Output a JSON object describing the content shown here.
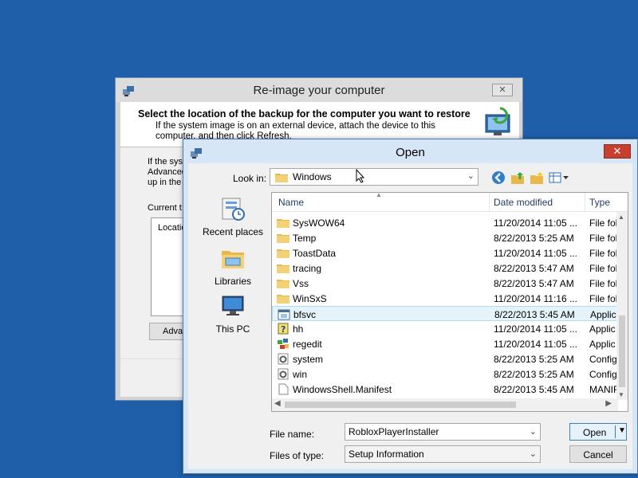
{
  "reimage": {
    "title": "Re-image your computer",
    "header_title": "Select the location of the backup for the computer you want to restore",
    "header_desc": "If the system image is on an external device, attach the device to this computer, and then click Refresh.",
    "body_text": "If the sys Advanced up in the",
    "current_label": "Current t",
    "list_column": "Location",
    "advanced_button": "Adva",
    "close_glyph": "✕"
  },
  "open_dialog": {
    "title": "Open",
    "close_glyph": "✕",
    "look_in_label": "Look in:",
    "look_in_value": "Windows",
    "places": [
      {
        "label": "Recent places",
        "icon": "recent-places-icon"
      },
      {
        "label": "Libraries",
        "icon": "libraries-icon"
      },
      {
        "label": "This PC",
        "icon": "this-pc-icon"
      }
    ],
    "columns": {
      "name": "Name",
      "date": "Date modified",
      "type": "Type"
    },
    "files": [
      {
        "name": "SysWOW64",
        "date": "11/20/2014 11:05 ...",
        "type": "File fol",
        "icon": "folder-icon"
      },
      {
        "name": "Temp",
        "date": "8/22/2013 5:25 AM",
        "type": "File fol",
        "icon": "folder-icon"
      },
      {
        "name": "ToastData",
        "date": "11/20/2014 11:05 ...",
        "type": "File fol",
        "icon": "folder-icon"
      },
      {
        "name": "tracing",
        "date": "8/22/2013 5:47 AM",
        "type": "File fol",
        "icon": "folder-icon"
      },
      {
        "name": "Vss",
        "date": "8/22/2013 5:47 AM",
        "type": "File fol",
        "icon": "folder-icon"
      },
      {
        "name": "WinSxS",
        "date": "11/20/2014 11:16 ...",
        "type": "File fol",
        "icon": "folder-icon"
      },
      {
        "name": "bfsvc",
        "date": "8/22/2013 5:45 AM",
        "type": "Applic",
        "icon": "application-icon"
      },
      {
        "name": "hh",
        "date": "11/20/2014 11:05 ...",
        "type": "Applic",
        "icon": "help-app-icon"
      },
      {
        "name": "regedit",
        "date": "11/20/2014 11:05 ...",
        "type": "Applic",
        "icon": "regedit-icon"
      },
      {
        "name": "system",
        "date": "8/22/2013 5:25 AM",
        "type": "Config",
        "icon": "config-icon"
      },
      {
        "name": "win",
        "date": "8/22/2013 5:25 AM",
        "type": "Config",
        "icon": "config-icon"
      },
      {
        "name": "WindowsShell.Manifest",
        "date": "8/22/2013 5:45 AM",
        "type": "MANIF",
        "icon": "file-icon"
      }
    ],
    "file_name_label": "File name:",
    "file_name_value": "RobloxPlayerInstaller",
    "files_of_type_label": "Files of type:",
    "files_of_type_value": "Setup Information",
    "open_button": "Open",
    "cancel_button": "Cancel"
  },
  "colors": {
    "desktop": "#1f5ea8",
    "dialog_frame": "#d6e6f6",
    "close_red": "#c7402f",
    "selection": "#e5f3fb"
  }
}
